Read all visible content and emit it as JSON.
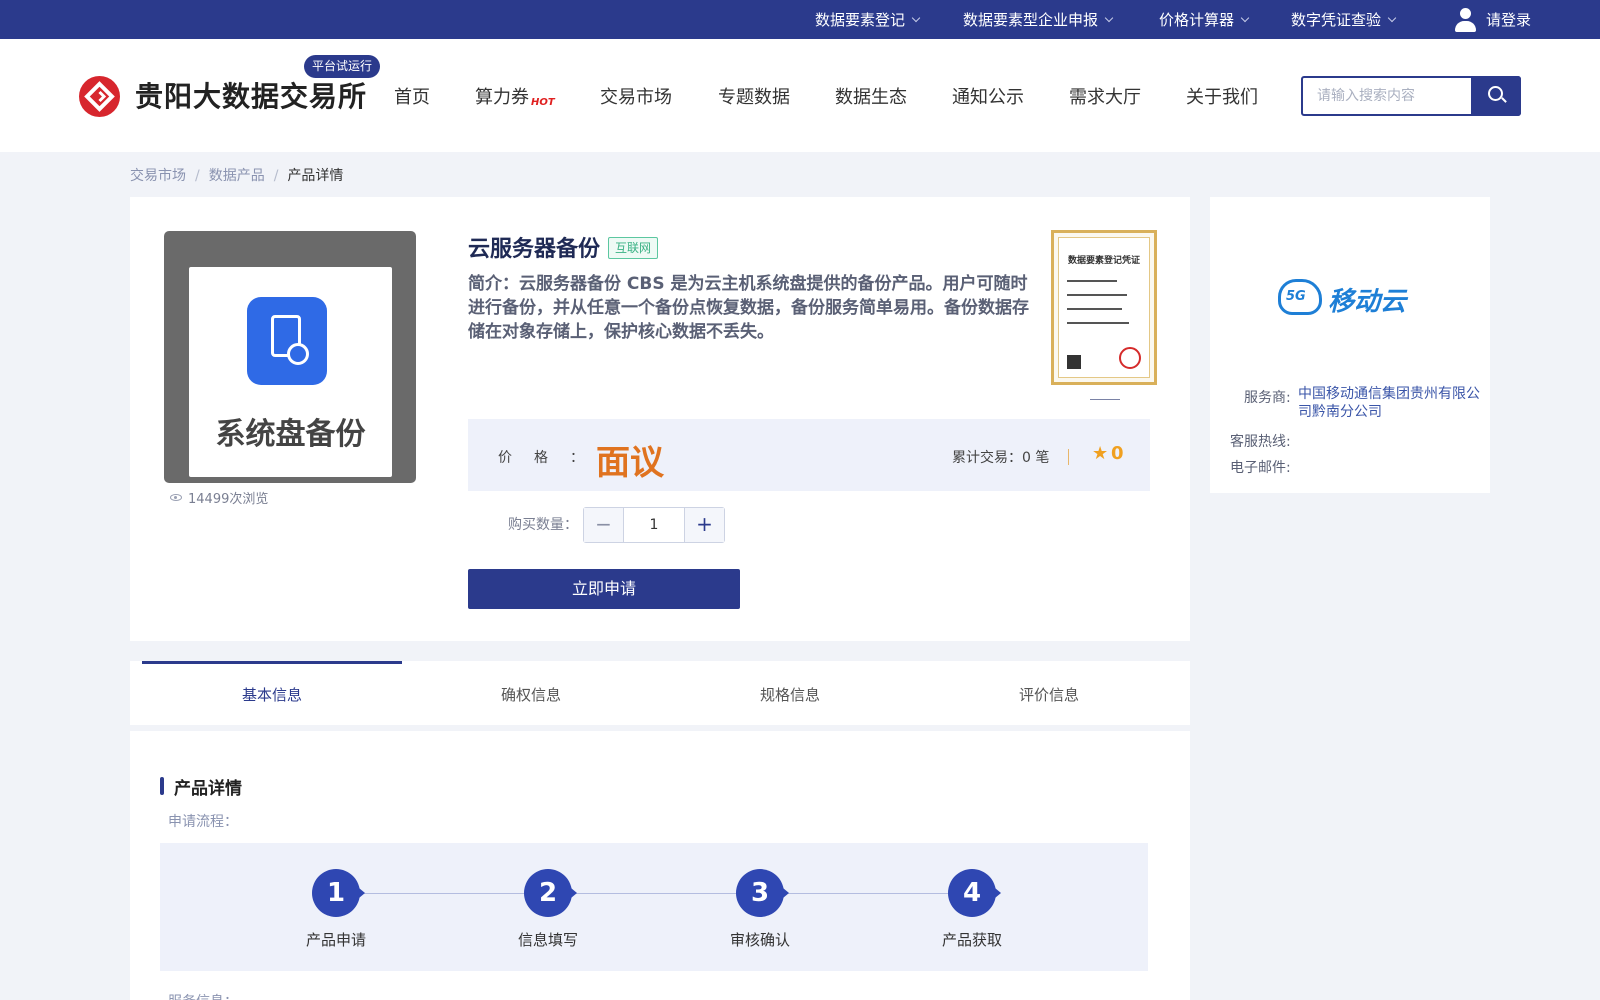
{
  "topbar": {
    "links": [
      "数据要素登记",
      "数据要素型企业申报",
      "价格计算器",
      "数字凭证查验"
    ],
    "login": "请登录"
  },
  "header": {
    "logo_text": "贵阳大数据交易所",
    "beta_badge": "平台试运行",
    "nav": [
      "首页",
      "算力券",
      "交易市场",
      "专题数据",
      "数据生态",
      "通知公示",
      "需求大厅",
      "关于我们"
    ],
    "hot_badge": "HOT",
    "search_placeholder": "请输入搜索内容"
  },
  "breadcrumb": [
    "交易市场",
    "数据产品",
    "产品详情"
  ],
  "product": {
    "image_caption": "系统盘备份",
    "views": "14499次浏览",
    "title": "云服务器备份",
    "tag": "互联网",
    "description": "简介：云服务器备份 CBS 是为云主机系统盘提供的备份产品。用户可随时进行备份，并从任意一个备份点恢复数据，备份服务简单易用。备份数据存储在对象存储上，保护核心数据不丢失。",
    "certificate_title": "数据要素登记凭证",
    "price_label": "价格：",
    "price": "面议",
    "trades": "累计交易：",
    "trade_count": "0 笔",
    "rating": "0",
    "qty_label": "购买数量：",
    "quantity": "1",
    "apply_button": "立即申请"
  },
  "provider": {
    "brand": "移动云",
    "brand_prefix": "5G",
    "provider_label": "服务商:",
    "provider_name": "中国移动通信集团贵州有限公司黔南分公司",
    "hotline_label": "客服热线:",
    "email_label": "电子邮件:"
  },
  "tabs": [
    "基本信息",
    "确权信息",
    "规格信息",
    "评价信息"
  ],
  "detail": {
    "section_title": "产品详情",
    "flow_label": "申请流程：",
    "steps": [
      {
        "num": "1",
        "label": "产品申请"
      },
      {
        "num": "2",
        "label": "信息填写"
      },
      {
        "num": "3",
        "label": "审核确认"
      },
      {
        "num": "4",
        "label": "产品获取"
      }
    ],
    "service_label": "服务信息："
  },
  "colors": {
    "primary": "#2b3a8c",
    "logo_red": "#d7262d",
    "price": "#e0731f",
    "tag_green": "#3ab184",
    "brand_blue": "#1e7fd6"
  }
}
